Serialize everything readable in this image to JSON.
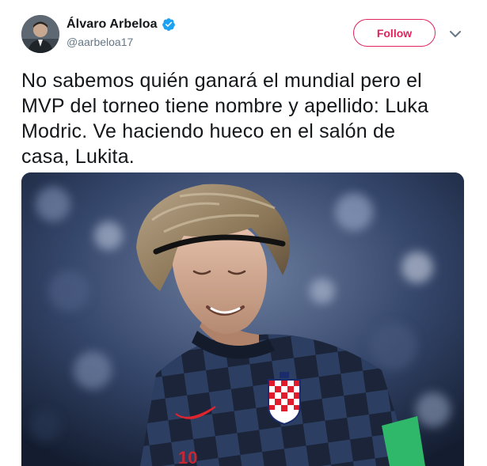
{
  "tweet": {
    "author": {
      "display_name": "Álvaro Arbeloa",
      "handle": "@aarbeloa17",
      "verified": true
    },
    "follow_label": "Follow",
    "text": "No sabemos quién ganará el mundial  pero el\nMVP del torneo tiene nombre y apellido: Luka\nModric. Ve haciendo hueco en el salón de\ncasa, Lukita.",
    "colors": {
      "follow_accent": "#e0245e",
      "verified_badge": "#1da1f2",
      "handle_gray": "#657786"
    },
    "icons": {
      "verified": "verified-badge-icon",
      "caret": "chevron-down-icon"
    },
    "media": {
      "kind": "photo"
    }
  }
}
